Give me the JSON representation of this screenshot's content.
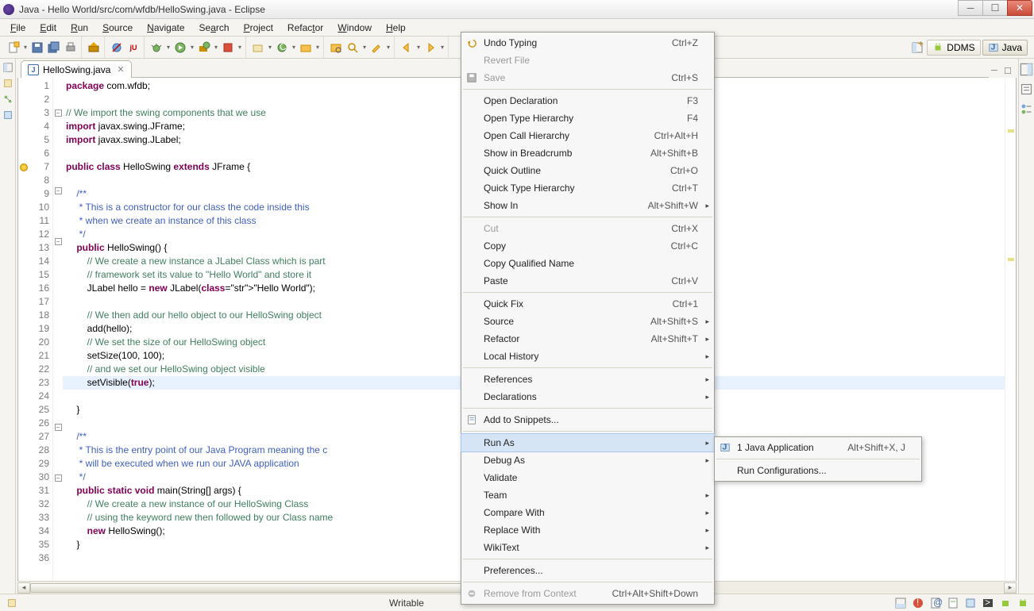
{
  "window": {
    "title": "Java - Hello World/src/com/wfdb/HelloSwing.java - Eclipse"
  },
  "menus": [
    "File",
    "Edit",
    "Run",
    "Source",
    "Navigate",
    "Search",
    "Project",
    "Refactor",
    "Window",
    "Help"
  ],
  "perspectives": {
    "ddms": "DDMS",
    "java": "Java"
  },
  "editor": {
    "tab": "HelloSwing.java",
    "line_start": 1,
    "lines": [
      "package com.wfdb;",
      "",
      "// We import the swing components that we use",
      "import javax.swing.JFrame;",
      "import javax.swing.JLabel;",
      "",
      "public class HelloSwing extends JFrame {",
      "",
      "    /**",
      "     * This is a constructor for our class the code inside this",
      "     * when we create an instance of this class",
      "     */",
      "    public HelloSwing() {",
      "        // We create a new instance a JLabel Class which is part",
      "        // framework set its value to \"Hello World\" and store it",
      "        JLabel hello = new JLabel(\"Hello World\");",
      "",
      "        // We then add our hello object to our HelloSwing object",
      "        add(hello);",
      "        // We set the size of our HelloSwing object",
      "        setSize(100, 100);",
      "        // and we set our HelloSwing object visible",
      "        setVisible(true);",
      "    ",
      "    }",
      "",
      "    /**",
      "     * This is the entry point of our Java Program meaning the c",
      "     * will be executed when we run our JAVA application",
      "     */",
      "    public static void main(String[] args) {",
      "        // We create a new instance of our HelloSwing Class",
      "        // using the keyword new then followed by our Class name",
      "        new HelloSwing();",
      "    }",
      ""
    ],
    "highlight_line": 23
  },
  "context_menu": [
    {
      "label": "Undo Typing",
      "shortcut": "Ctrl+Z",
      "icon": "undo"
    },
    {
      "label": "Revert File",
      "disabled": true
    },
    {
      "label": "Save",
      "shortcut": "Ctrl+S",
      "icon": "save",
      "disabled": true
    },
    {
      "sep": true
    },
    {
      "label": "Open Declaration",
      "shortcut": "F3"
    },
    {
      "label": "Open Type Hierarchy",
      "shortcut": "F4"
    },
    {
      "label": "Open Call Hierarchy",
      "shortcut": "Ctrl+Alt+H"
    },
    {
      "label": "Show in Breadcrumb",
      "shortcut": "Alt+Shift+B"
    },
    {
      "label": "Quick Outline",
      "shortcut": "Ctrl+O"
    },
    {
      "label": "Quick Type Hierarchy",
      "shortcut": "Ctrl+T"
    },
    {
      "label": "Show In",
      "shortcut": "Alt+Shift+W",
      "submenu": true
    },
    {
      "sep": true
    },
    {
      "label": "Cut",
      "shortcut": "Ctrl+X",
      "disabled": true
    },
    {
      "label": "Copy",
      "shortcut": "Ctrl+C"
    },
    {
      "label": "Copy Qualified Name"
    },
    {
      "label": "Paste",
      "shortcut": "Ctrl+V"
    },
    {
      "sep": true
    },
    {
      "label": "Quick Fix",
      "shortcut": "Ctrl+1"
    },
    {
      "label": "Source",
      "shortcut": "Alt+Shift+S",
      "submenu": true
    },
    {
      "label": "Refactor",
      "shortcut": "Alt+Shift+T",
      "submenu": true
    },
    {
      "label": "Local History",
      "submenu": true
    },
    {
      "sep": true
    },
    {
      "label": "References",
      "submenu": true
    },
    {
      "label": "Declarations",
      "submenu": true
    },
    {
      "sep": true
    },
    {
      "label": "Add to Snippets...",
      "icon": "snippet"
    },
    {
      "sep": true
    },
    {
      "label": "Run As",
      "submenu": true,
      "highlight": true
    },
    {
      "label": "Debug As",
      "submenu": true
    },
    {
      "label": "Validate"
    },
    {
      "label": "Team",
      "submenu": true
    },
    {
      "label": "Compare With",
      "submenu": true
    },
    {
      "label": "Replace With",
      "submenu": true
    },
    {
      "label": "WikiText",
      "submenu": true
    },
    {
      "sep": true
    },
    {
      "label": "Preferences..."
    },
    {
      "sep": true
    },
    {
      "label": "Remove from Context",
      "shortcut": "Ctrl+Alt+Shift+Down",
      "icon": "remove",
      "disabled": true
    }
  ],
  "run_as_menu": [
    {
      "label": "1 Java Application",
      "shortcut": "Alt+Shift+X, J",
      "icon": "java-app"
    },
    {
      "sep": true
    },
    {
      "label": "Run Configurations..."
    }
  ],
  "statusbar": {
    "writable": "Writable"
  }
}
